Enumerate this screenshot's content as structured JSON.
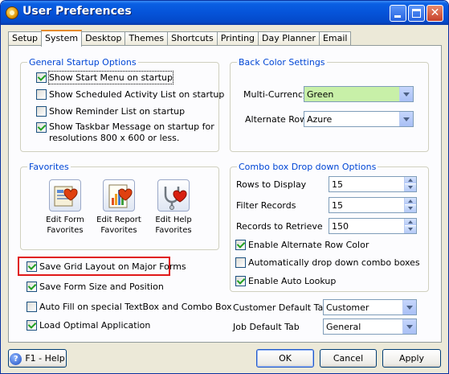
{
  "window": {
    "title": "User Preferences"
  },
  "tabs": [
    "Setup",
    "System",
    "Desktop",
    "Themes",
    "Shortcuts",
    "Printing",
    "Day Planner",
    "Email"
  ],
  "active_tab": "System",
  "general_startup": {
    "legend": "General Startup Options",
    "items": [
      {
        "label": "Show Start Menu on startup",
        "checked": true
      },
      {
        "label": "Show Scheduled Activity List on startup",
        "checked": false
      },
      {
        "label": "Show Reminder List on startup",
        "checked": false
      },
      {
        "label": "Show Taskbar Message on startup for resolutions 800 x 600 or less.",
        "checked": true
      }
    ]
  },
  "back_color": {
    "legend": "Back Color Settings",
    "multi_currency_label": "Multi-Currency",
    "multi_currency_value": "Green",
    "multi_currency_color": "#c8f0a8",
    "alternate_row_label": "Alternate Row",
    "alternate_row_value": "Azure"
  },
  "favorites": {
    "legend": "Favorites",
    "items": [
      {
        "label": "Edit Form Favorites",
        "icon": "form-favorites-icon"
      },
      {
        "label": "Edit Report Favorites",
        "icon": "report-favorites-icon"
      },
      {
        "label": "Edit Help Favorites",
        "icon": "help-favorites-icon"
      }
    ]
  },
  "combo_options": {
    "legend": "Combo box Drop down Options",
    "rows_label": "Rows to Display",
    "rows_value": "15",
    "filter_label": "Filter Records",
    "filter_value": "15",
    "retrieve_label": "Records to Retrieve",
    "retrieve_value": "150",
    "checks": [
      {
        "label": "Enable Alternate Row Color",
        "checked": true
      },
      {
        "label": "Automatically drop down combo boxes",
        "checked": false
      },
      {
        "label": "Enable Auto Lookup",
        "checked": true
      }
    ]
  },
  "lower_checks": [
    {
      "label": "Save Grid Layout on Major Forms",
      "checked": true
    },
    {
      "label": "Save Form Size and Position",
      "checked": true
    },
    {
      "label": "Auto Fill on special TextBox and Combo Box",
      "checked": false
    },
    {
      "label": "Load Optimal Application",
      "checked": true
    }
  ],
  "customer_tab": {
    "label": "Customer Default Tab",
    "value": "Customer"
  },
  "job_tab": {
    "label": "Job Default Tab",
    "value": "General"
  },
  "buttons": {
    "help": "F1 - Help",
    "ok": "OK",
    "cancel": "Cancel",
    "apply": "Apply"
  }
}
